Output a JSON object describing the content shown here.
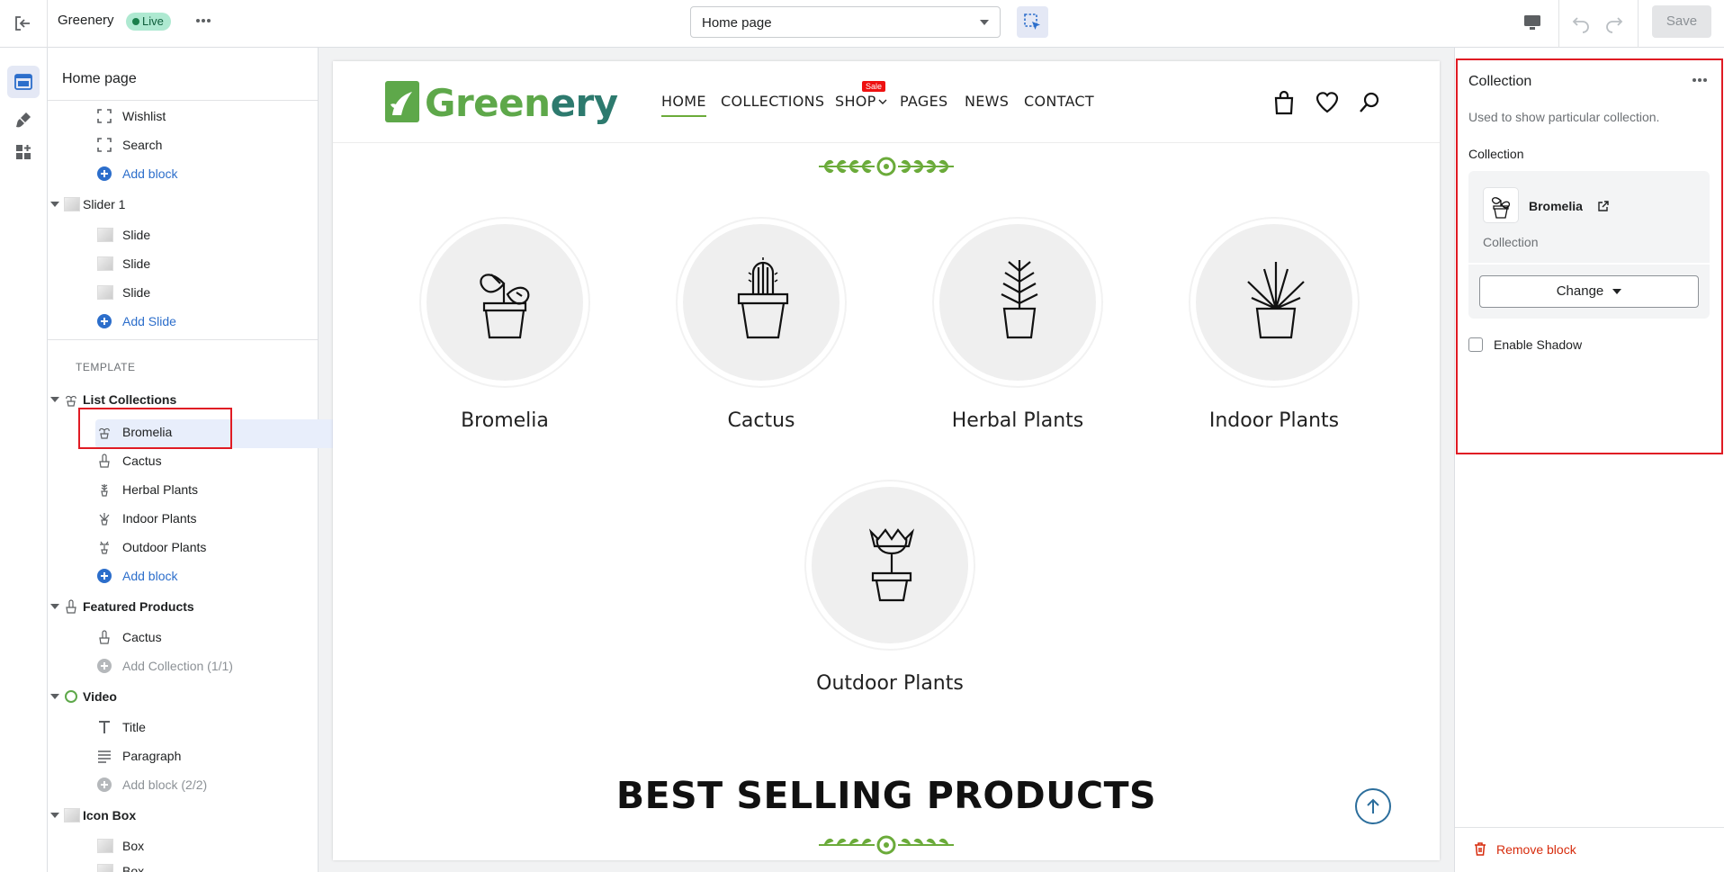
{
  "topbar": {
    "store_name": "Greenery",
    "status_badge": "Live",
    "page_select": "Home page",
    "save_label": "Save"
  },
  "rail": {
    "icons": [
      "sections-icon",
      "theme-settings-icon",
      "app-embeds-icon"
    ]
  },
  "left_panel": {
    "title": "Home page",
    "template_label": "TEMPLATE",
    "header_blocks": [
      "Wishlist",
      "Search"
    ],
    "add_block": "Add block",
    "slider": {
      "name": "Slider 1",
      "items": [
        "Slide",
        "Slide",
        "Slide"
      ],
      "add": "Add Slide"
    },
    "list_collections": {
      "name": "List Collections",
      "items": [
        "Bromelia",
        "Cactus",
        "Herbal Plants",
        "Indoor Plants",
        "Outdoor Plants"
      ],
      "add": "Add block"
    },
    "featured_products": {
      "name": "Featured Products",
      "items": [
        "Cactus"
      ],
      "add": "Add Collection (1/1)"
    },
    "video": {
      "name": "Video",
      "items": [
        "Title",
        "Paragraph"
      ],
      "add": "Add block (2/2)"
    },
    "icon_box": {
      "name": "Icon Box",
      "items": [
        "Box",
        "Box"
      ]
    }
  },
  "preview": {
    "logo_text_a": "Green",
    "logo_text_b": "ery",
    "nav": [
      "HOME",
      "COLLECTIONS",
      "SHOP",
      "PAGES",
      "NEWS",
      "CONTACT"
    ],
    "sale_badge": "Sale",
    "collections": [
      "Bromelia",
      "Cactus",
      "Herbal Plants",
      "Indoor Plants",
      "Outdoor Plants"
    ],
    "section_heading": "BEST SELLING PRODUCTS"
  },
  "right_panel": {
    "title": "Collection",
    "description": "Used to show particular collection.",
    "field_label": "Collection",
    "selected_name": "Bromelia",
    "selected_sub": "Collection",
    "change_label": "Change",
    "enable_shadow": "Enable Shadow",
    "enable_shadow_checked": false,
    "remove_label": "Remove block"
  },
  "colors": {
    "accent": "#2c6ecb",
    "highlight": "#e01b24",
    "brand_green": "#5ea84a",
    "brand_teal": "#2d7a6e",
    "live_badge": "#aee9d1"
  }
}
